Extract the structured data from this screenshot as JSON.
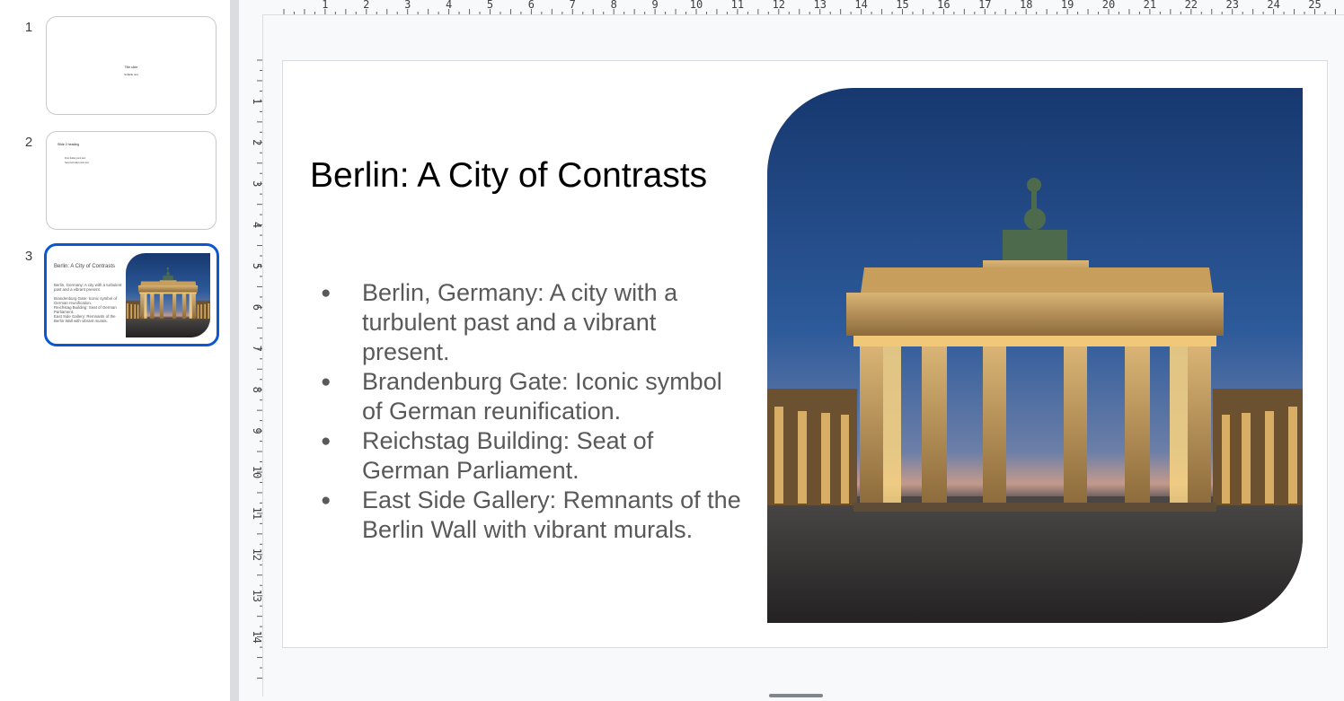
{
  "filmstrip": {
    "slides": [
      {
        "number": "1",
        "title": "Title slide",
        "subtitle": "Subtitle text"
      },
      {
        "number": "2",
        "title": "Slide 2 heading",
        "bullets": [
          "First bullet point text",
          "Second bullet point text"
        ]
      },
      {
        "number": "3",
        "title": "Berlin: A City of Contrasts",
        "bullets": [
          "Berlin, Germany: A city with a turbulent past and a vibrant present.",
          "Brandenburg Gate: Iconic symbol of German reunification.",
          "Reichstag Building: Seat of German Parliament.",
          "East Side Gallery: Remnants of the Berlin Wall with vibrant murals."
        ],
        "selected": true
      }
    ],
    "selected_color": "#0b57d0"
  },
  "rulers": {
    "horizontal_labels": [
      "1",
      "2",
      "3",
      "4",
      "5",
      "6",
      "7",
      "8",
      "9",
      "10",
      "11",
      "12",
      "13",
      "14",
      "15",
      "16",
      "17",
      "18",
      "19",
      "20",
      "21",
      "22",
      "23",
      "24",
      "25"
    ],
    "vertical_labels": [
      "1",
      "2",
      "3",
      "4",
      "5",
      "6",
      "7",
      "8",
      "9",
      "10",
      "11",
      "12",
      "13",
      "14"
    ]
  },
  "slide": {
    "title": "Berlin: A City of Contrasts",
    "bullets": [
      "Berlin, Germany: A city with a turbulent past and a vibrant present.",
      "Brandenburg Gate: Iconic symbol of German reunification.",
      "Reichstag Building: Seat of German Parliament.",
      "East Side Gallery: Remnants of the Berlin Wall with vibrant murals."
    ],
    "image": "brandenburg-gate-at-dusk"
  }
}
